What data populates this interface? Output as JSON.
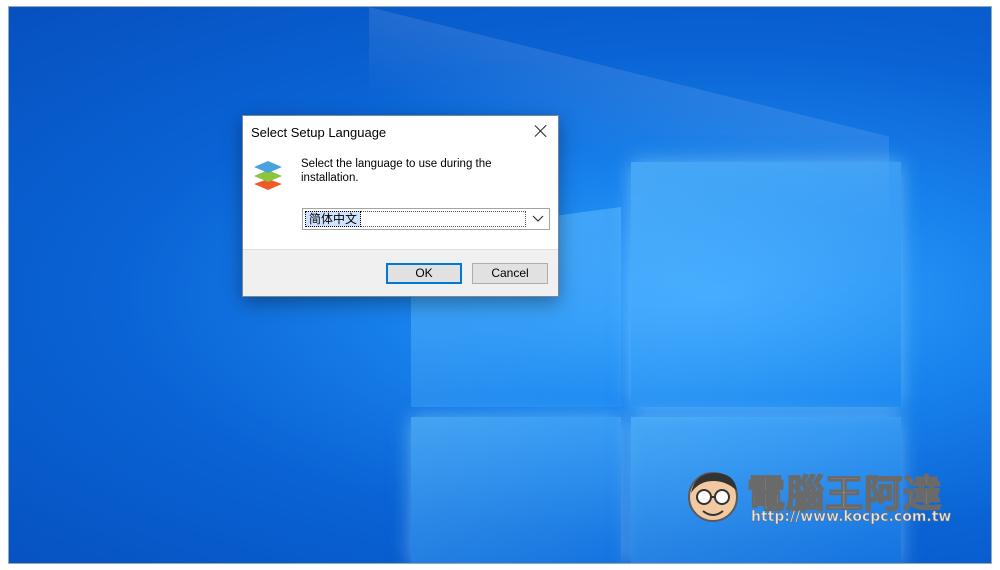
{
  "dialog": {
    "title": "Select Setup Language",
    "prompt": "Select the language to use during the installation.",
    "language_select": {
      "selected": "简体中文"
    },
    "ok_label": "OK",
    "cancel_label": "Cancel"
  },
  "watermark": {
    "title": "電腦王阿達",
    "url": "http://www.kocpc.com.tw"
  },
  "colors": {
    "desktop_blue": "#0a63d4",
    "focus_blue": "#0078d7",
    "icon_layers": [
      "#4aa3df",
      "#8cc63f",
      "#f05a28"
    ]
  }
}
